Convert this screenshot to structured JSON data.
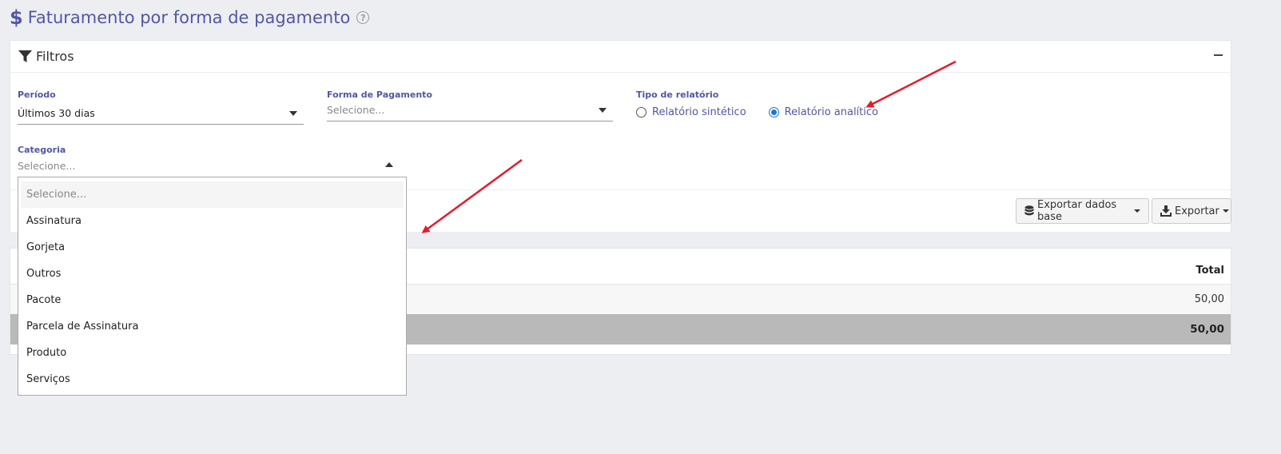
{
  "header": {
    "title": "Faturamento por forma de pagamento",
    "dollar_glyph": "$",
    "help_glyph": "?"
  },
  "filters": {
    "title": "Filtros",
    "periodo": {
      "label": "Período",
      "value": "Últimos 30 dias"
    },
    "forma_pagamento": {
      "label": "Forma de Pagamento",
      "placeholder": "Selecione..."
    },
    "tipo_relatorio": {
      "label": "Tipo de relatório",
      "options": [
        {
          "label": "Relatório sintético",
          "checked": false
        },
        {
          "label": "Relatório analítico",
          "checked": true
        }
      ]
    },
    "categoria": {
      "label": "Categoria",
      "placeholder": "Selecione...",
      "open": true,
      "options": [
        "Selecione...",
        "Assinatura",
        "Gorjeta",
        "Outros",
        "Pacote",
        "Parcela de Assinatura",
        "Produto",
        "Serviços"
      ]
    },
    "buttons": {
      "export_base": "Exportar dados base",
      "export": "Exportar"
    }
  },
  "results": {
    "header_total": "Total",
    "rows": [
      {
        "total": "50,00"
      }
    ],
    "footer_total": "50,00"
  },
  "colors": {
    "accent": "#5157a8",
    "radio_checked": "#1a73e8",
    "annotation_arrow": "#e8192c",
    "total_row_bg": "#b9b9b9"
  }
}
